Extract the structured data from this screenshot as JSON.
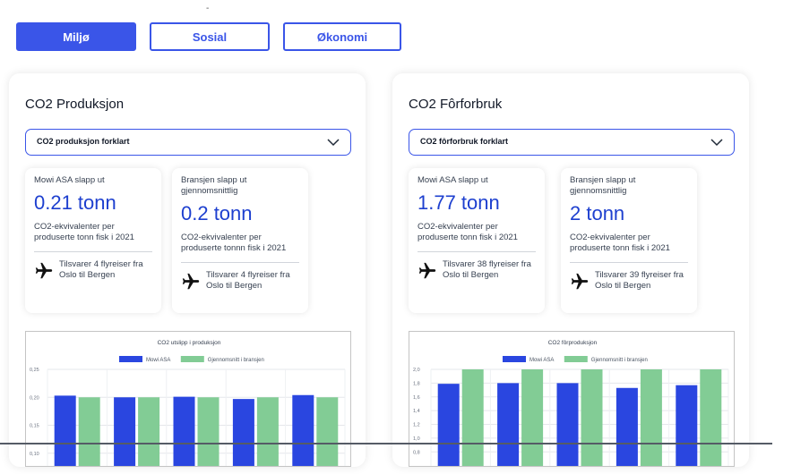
{
  "top_mark": "-",
  "tabs": [
    {
      "label": "Miljø",
      "active": true
    },
    {
      "label": "Sosial",
      "active": false
    },
    {
      "label": "Økonomi",
      "active": false
    }
  ],
  "panels": [
    {
      "title": "CO2 Produksjon",
      "dropdown": "CO2 produksjon forklart",
      "cards": [
        {
          "who": "Mowi ASA slapp ut",
          "value": "0.21 tonn",
          "desc": "CO2-ekvivalenter per produserte tonn fisk i 2021",
          "flight": "Tilsvarer 4 flyreiser fra Oslo til Bergen",
          "icon": "airplane-icon"
        },
        {
          "who": "Bransjen slapp ut gjennomsnittlig",
          "value": "0.2 tonn",
          "desc": "CO2-ekvivalenter per produserte tonnn fisk i 2021",
          "flight": "Tilsvarer 4 flyreiser fra Oslo til Bergen",
          "icon": "airplane-icon"
        }
      ]
    },
    {
      "title": "CO2 Fôrforbruk",
      "dropdown": "CO2 fôrforbruk forklart",
      "cards": [
        {
          "who": "Mowi ASA slapp ut",
          "value": "1.77 tonn",
          "desc": "CO2-ekvivalenter per produserte tonn fisk i 2021",
          "flight": "Tilsvarer 38 flyreiser fra Oslo til Bergen",
          "icon": "airplane-icon"
        },
        {
          "who": "Bransjen slapp ut gjennomsnittlig",
          "value": "2 tonn",
          "desc": "CO2-ekvivalenter per produserte tonn fisk i 2021",
          "flight": "Tilsvarer 39 flyreiser fra Oslo til Bergen",
          "icon": "airplane-icon"
        }
      ]
    }
  ],
  "colors": {
    "accent": "#3a55e8",
    "mowi": "#2a46e0",
    "industry": "#82cc95"
  },
  "chart_data": [
    {
      "type": "bar",
      "title": "CO2 utslipp i produksjon",
      "series": [
        {
          "name": "Mowi ASA",
          "values": [
            0.203,
            0.2,
            0.201,
            0.197,
            0.204
          ]
        },
        {
          "name": "Gjennomsnitt i bransjen",
          "values": [
            0.2,
            0.2,
            0.2,
            0.2,
            0.2
          ]
        }
      ],
      "yticks": [
        "0,25",
        "0,20",
        "0,15",
        "0,10"
      ],
      "ylim": [
        0.09,
        0.25
      ],
      "grid": true,
      "legend": "top"
    },
    {
      "type": "bar",
      "title": "CO2 fôrproduksjon",
      "series": [
        {
          "name": "Mowi ASA",
          "values": [
            1.79,
            1.8,
            1.8,
            1.73,
            1.77
          ]
        },
        {
          "name": "Gjennomsnitt i bransjen",
          "values": [
            2.0,
            2.0,
            2.0,
            2.0,
            2.0
          ]
        }
      ],
      "yticks": [
        "2,0",
        "1,8",
        "1,6",
        "1,4",
        "1,2",
        "1,0",
        "0,8"
      ],
      "ylim": [
        0.7,
        2.0
      ],
      "grid": true,
      "legend": "top"
    }
  ]
}
